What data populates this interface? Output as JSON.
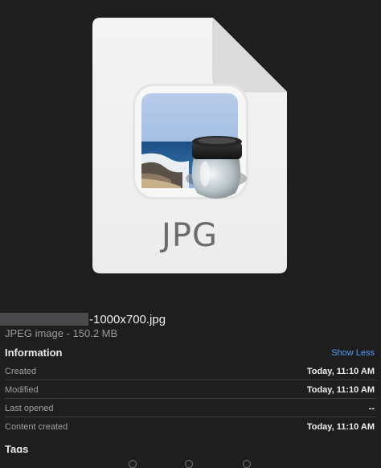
{
  "preview": {
    "file_icon": "jpg-document-icon",
    "app_icon": "preview-app-icon",
    "extension_label": "JPG"
  },
  "file": {
    "name_suffix": "-1000x700.jpg",
    "kind_size": "JPEG image - 150.2 MB"
  },
  "information": {
    "header": "Information",
    "toggle_label": "Show Less",
    "rows": [
      {
        "key": "Created",
        "value": "Today, 11:10 AM"
      },
      {
        "key": "Modified",
        "value": "Today, 11:10 AM"
      },
      {
        "key": "Last opened",
        "value": "--"
      },
      {
        "key": "Content created",
        "value": "Today, 11:10 AM"
      }
    ]
  },
  "tags": {
    "header": "Tags"
  },
  "colors": {
    "background": "#1f1e1f",
    "accent_link": "#4d9cf8",
    "divider": "#3a393b"
  }
}
